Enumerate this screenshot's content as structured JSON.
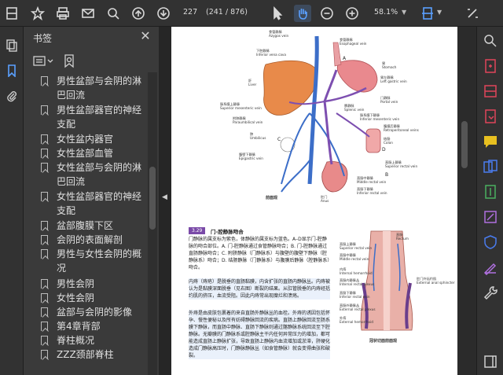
{
  "toolbar": {
    "current_page": "227",
    "page_count": "(241 / 876)",
    "zoom": "58.1%"
  },
  "bookmarks": {
    "title": "书签",
    "items": [
      {
        "label": "男性盆部与会阴的淋巴回流"
      },
      {
        "label": "男性盆部器官的神经支配"
      },
      {
        "label": "女性盆内器官"
      },
      {
        "label": "女性盆部血管"
      },
      {
        "label": "女性盆部与会阴的淋巴回流"
      },
      {
        "label": "女性盆部器官的神经支配"
      },
      {
        "label": "盆部腹膜下区"
      },
      {
        "label": "会阴的表面解剖"
      },
      {
        "label": "男性与女性会阴的概况"
      },
      {
        "label": "男性会阴"
      },
      {
        "label": "女性会阴"
      },
      {
        "label": "盆部与会阴的影像"
      },
      {
        "label": "第4章背部"
      },
      {
        "label": "脊柱概况"
      },
      {
        "label": "ZZZ颈部脊柱"
      }
    ]
  },
  "pdf": {
    "fig_top_labels": [
      {
        "cn": "食管静脉",
        "en": "Azygos vein"
      },
      {
        "cn": "下腔静脉",
        "en": "Inferior vena cava"
      },
      {
        "cn": "食管静脉",
        "en": "Esophageal vein"
      },
      {
        "cn": "胃",
        "en": "Stomach"
      },
      {
        "cn": "胃左静脉",
        "en": "Left gastric vein"
      },
      {
        "cn": "门静脉",
        "en": "Portal vein"
      },
      {
        "cn": "脾静脉",
        "en": "Splenic vein"
      },
      {
        "cn": "肠系膜下静脉",
        "en": "Inferior mesenteric vein"
      },
      {
        "cn": "腹膜后静脉",
        "en": "Retroperitoneal veins"
      },
      {
        "cn": "结肠",
        "en": "Colon"
      },
      {
        "cn": "直肠上静脉",
        "en": "Superior rectal vein"
      },
      {
        "cn": "直肠中静脉",
        "en": "Middle rectal vein"
      },
      {
        "cn": "直肠下静脉",
        "en": "Inferior rectal vein"
      },
      {
        "cn": "肝",
        "en": "Liver"
      },
      {
        "cn": "肠系膜上静脉",
        "en": "Superior mesenteric vein"
      },
      {
        "cn": "附脐静脉",
        "en": "Paraumbilical vein"
      },
      {
        "cn": "脐",
        "en": "Umbilicus"
      },
      {
        "cn": "腹壁下静脉",
        "en": "Epigastric vein"
      },
      {
        "cn": "肛门",
        "en": "Anus"
      }
    ],
    "fig_caption": "前面观",
    "section_number": "3.29",
    "section_title": "门-腔静脉吻合",
    "paragraphs": [
      "门静脉的属支标为紫色，体静脉的属支标为蓝色。A–D显示门-腔静脉的吻合部位。A. 门-腔静脉通过食管静脉吻合；B. 门-腔静脉通过直肠静脉吻合；C. 附脐静脉（门静脉系）与腹壁的腹壁下静脉（腔静脉系）吻合；D. 结肠静脉（门静脉系）与腹膜后静脉（腔静脉系）吻合。",
      "内痔（痔疮）是脱垂的直肠黏膜，内含扩张的直肠内静脉丛。内痔被认为是黏膜深面脱垂（见右图）断裂的结果。从肛管脱垂的内痔经括约肌的挤压，血流受阻。因此内痔常出现糜烂和溃疡。",
      "外痔是由皮肤包裹着的来自直肠外静脉丛的血栓。外痔的诱因包括怀孕、慢性便秘以及所有妨碍静脉回流的疾病。直肠上静脉回流至肠系膜下静脉，而直肠中静脉、直肠下静脉则通过髂静脉系统回流至下腔静脉。无瓣膜的门静脉系或腔静脉主干内任何异常压力的增加，都可能造成直肠上静脉扩张，导致直肠上静脉内血流增加或淤滞，肝硬化造成门静脉高压时，门静脉静脉丛（如食管静脉）就会变得曲张和破裂。"
    ],
    "right_fig_labels": [
      {
        "cn": "直肠",
        "en": "Rectum"
      },
      {
        "cn": "直肠上静脉",
        "en": "Superior rectal vein"
      },
      {
        "cn": "直肠中静脉",
        "en": "Middle rectal vein"
      },
      {
        "cn": "内痔",
        "en": "Internal hemorrhoid"
      },
      {
        "cn": "直肠内静脉丛",
        "en": "Internal rectal plexus"
      },
      {
        "cn": "直肠下静脉",
        "en": "Inferior rectal vein"
      },
      {
        "cn": "直肠外静脉丛",
        "en": "External rectal plexus"
      },
      {
        "cn": "外痔",
        "en": "External hemorrhoid"
      },
      {
        "cn": "肛门外括约肌",
        "en": "External anal sphincter"
      }
    ],
    "right_fig_caption": "冠状切面前面观"
  }
}
